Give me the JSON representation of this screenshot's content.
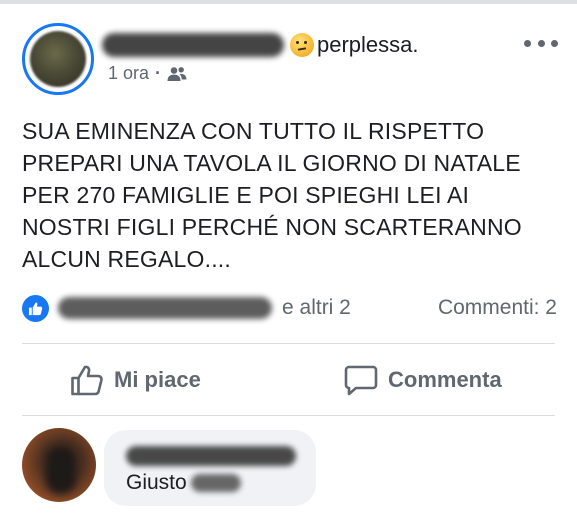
{
  "post": {
    "feeling": "perplessa.",
    "time": "1 ora",
    "separator": "·",
    "audience_icon": "friends-icon",
    "more_icon": "more-horizontal-icon",
    "text": "SUA EMINENZA CON TUTTO IL RISPETTO\nPREPARI UNA TAVOLA IL GIORNO DI NATALE\nPER 270 FAMIGLIE E POI SPIEGHI LEI AI\nNOSTRI FIGLI PERCHÉ NON SCARTERANNO\nALCUN REGALO...."
  },
  "reactions": {
    "icon": "like-reaction-icon",
    "others_text": "e altri 2",
    "comments_text": "Commenti: 2"
  },
  "actions": {
    "like_label": "Mi piace",
    "comment_label": "Commenta"
  },
  "comment": {
    "text": "Giusto"
  },
  "colors": {
    "accent": "#1877f2",
    "secondary_text": "#606770",
    "bubble": "#f0f2f5"
  }
}
